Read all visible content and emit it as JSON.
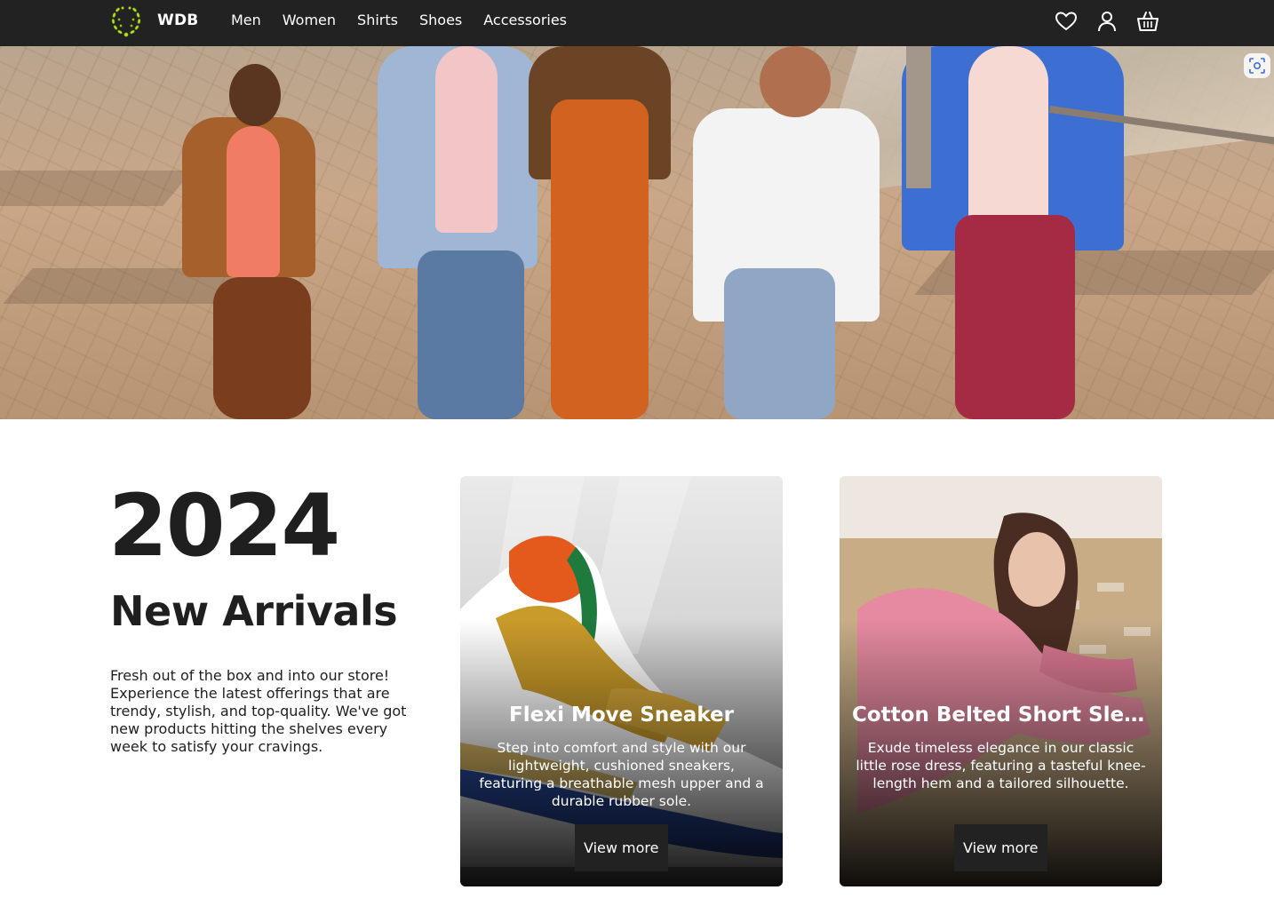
{
  "brand": {
    "name": "WDB",
    "logo_icon": "laurel-wreath-icon",
    "logo_color": "#b5e61d"
  },
  "nav": {
    "links": [
      "Men",
      "Women",
      "Shirts",
      "Shoes",
      "Accessories"
    ],
    "icons": [
      "heart-icon",
      "user-icon",
      "basket-icon"
    ]
  },
  "hero": {
    "image": "group-of-friends-walking-on-promenade",
    "overlay_button_icon": "visual-search-icon"
  },
  "intro": {
    "year": "2024",
    "heading": "New Arrivals",
    "text": "Fresh out of the box and into our store! Experience the latest offerings that are trendy, stylish, and top-quality. We've got new products hitting the shelves every week to satisfy your cravings."
  },
  "products": [
    {
      "title": "Flexi Move Sneaker",
      "description": "Step into comfort and style with our lightweight, cushioned sneakers, featuring a breathable mesh upper and a durable rubber sole.",
      "button": "View more",
      "image": "sneaker-photo"
    },
    {
      "title": "Cotton Belted Short Sleev...",
      "description": "Exude timeless elegance in our classic little rose dress, featuring a tasteful knee-length hem and a tailored silhouette.",
      "button": "View more",
      "image": "woman-in-pink-dress-photo"
    }
  ],
  "colors": {
    "navbar": "#222222",
    "text": "#1f1f1f",
    "button": "#222222"
  }
}
